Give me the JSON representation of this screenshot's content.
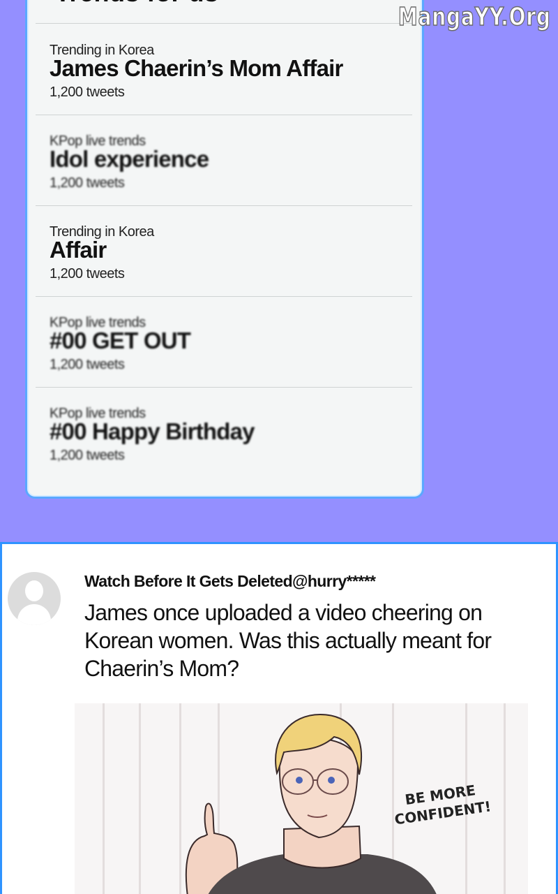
{
  "watermark": "MangaYY.Org",
  "card": {
    "title": "Trends for us",
    "trends": [
      {
        "category": "Trending in Korea",
        "name": "James Chaerin’s Mom Affair",
        "count": "1,200 tweets"
      },
      {
        "category": "KPop live trends",
        "name": "Idol experience",
        "count": "1,200 tweets"
      },
      {
        "category": "Trending in Korea",
        "name": "Affair",
        "count": "1,200 tweets"
      },
      {
        "category": "KPop live trends",
        "name": "#00 GET OUT",
        "count": "1,200 tweets"
      },
      {
        "category": "KPop live trends",
        "name": "#00 Happy Birthday",
        "count": "1,200 tweets"
      }
    ]
  },
  "post": {
    "handle": "Watch Before It Gets Deleted@hurry*****",
    "text": "James once uploaded a video cheering on Korean women. Was this actually meant for Chaerin’s Mom?",
    "speech_bubble": "BE MORE CONFIDENT!"
  }
}
